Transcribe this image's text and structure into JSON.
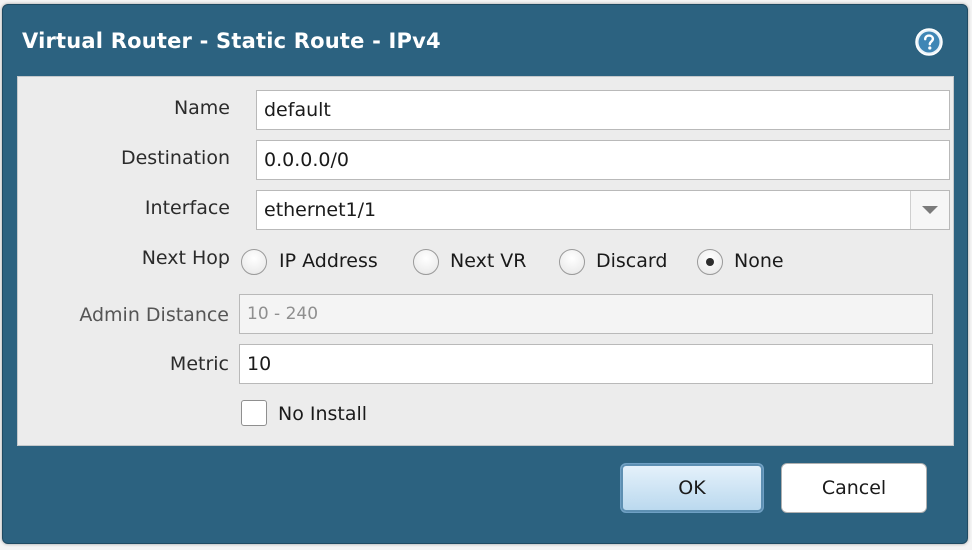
{
  "dialog": {
    "title": "Virtual Router - Static Route - IPv4",
    "help_icon": "help-icon",
    "accent_color": "#2c6280"
  },
  "form": {
    "name": {
      "label": "Name",
      "value": "default"
    },
    "destination": {
      "label": "Destination",
      "value": "0.0.0.0/0"
    },
    "interface": {
      "label": "Interface",
      "value": "ethernet1/1"
    },
    "next_hop": {
      "label": "Next Hop",
      "options": [
        "IP Address",
        "Next VR",
        "Discard",
        "None"
      ],
      "selected": "None"
    },
    "admin_distance": {
      "label": "Admin Distance",
      "placeholder": "10 - 240"
    },
    "metric": {
      "label": "Metric",
      "value": "10"
    },
    "no_install": {
      "label": "No Install",
      "checked": false
    }
  },
  "buttons": {
    "ok": "OK",
    "cancel": "Cancel"
  }
}
